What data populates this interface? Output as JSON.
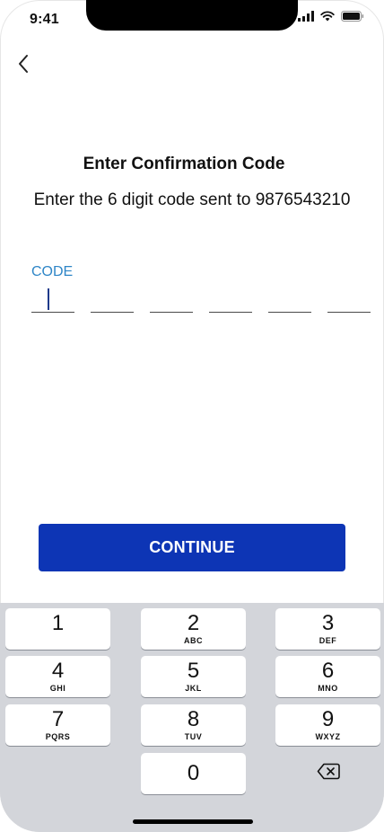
{
  "status_bar": {
    "time": "9:41"
  },
  "header": {
    "back_icon": "chevron-left-icon"
  },
  "main": {
    "title": "Enter Confirmation Code",
    "subtitle": "Enter the 6 digit code sent to 9876543210",
    "code_label": "CODE",
    "code_values": [
      "",
      "",
      "",
      "",
      "",
      ""
    ],
    "continue_label": "CONTINUE"
  },
  "keypad": {
    "keys": [
      {
        "digit": "1",
        "letters": ""
      },
      {
        "digit": "2",
        "letters": "ABC"
      },
      {
        "digit": "3",
        "letters": "DEF"
      },
      {
        "digit": "4",
        "letters": "GHI"
      },
      {
        "digit": "5",
        "letters": "JKL"
      },
      {
        "digit": "6",
        "letters": "MNO"
      },
      {
        "digit": "7",
        "letters": "PQRS"
      },
      {
        "digit": "8",
        "letters": "TUV"
      },
      {
        "digit": "9",
        "letters": "WXYZ"
      },
      {
        "digit": "0",
        "letters": ""
      }
    ],
    "delete_icon": "backspace-icon"
  },
  "colors": {
    "accent": "#0d35b5",
    "label": "#2f86c7",
    "keypad_bg": "#d3d5da"
  }
}
